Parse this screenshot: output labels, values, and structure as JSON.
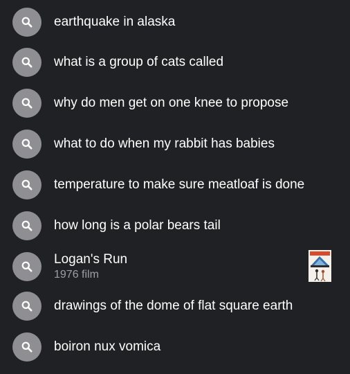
{
  "suggestions": [
    {
      "text": "earthquake in alaska",
      "icon": "search-icon"
    },
    {
      "text": "what is a group of cats called",
      "icon": "search-icon"
    },
    {
      "text": "why do men get on one knee to propose",
      "icon": "search-icon"
    },
    {
      "text": "what to do when my rabbit has babies",
      "icon": "search-icon"
    },
    {
      "text": "temperature to make sure meatloaf is done",
      "icon": "search-icon"
    },
    {
      "text": "how long is a polar bears tail",
      "icon": "search-icon"
    },
    {
      "text": "Logan's Run",
      "subtitle": "1976 film",
      "icon": "search-icon",
      "thumbnail": "movie-poster-thumbnail"
    },
    {
      "text": "drawings of the dome of flat square earth",
      "icon": "search-icon"
    },
    {
      "text": "boiron nux vomica",
      "icon": "search-icon"
    }
  ],
  "colors": {
    "background": "#202124",
    "icon_circle": "#8e8e93",
    "text": "#ffffff",
    "subtitle": "#9aa0a6"
  }
}
